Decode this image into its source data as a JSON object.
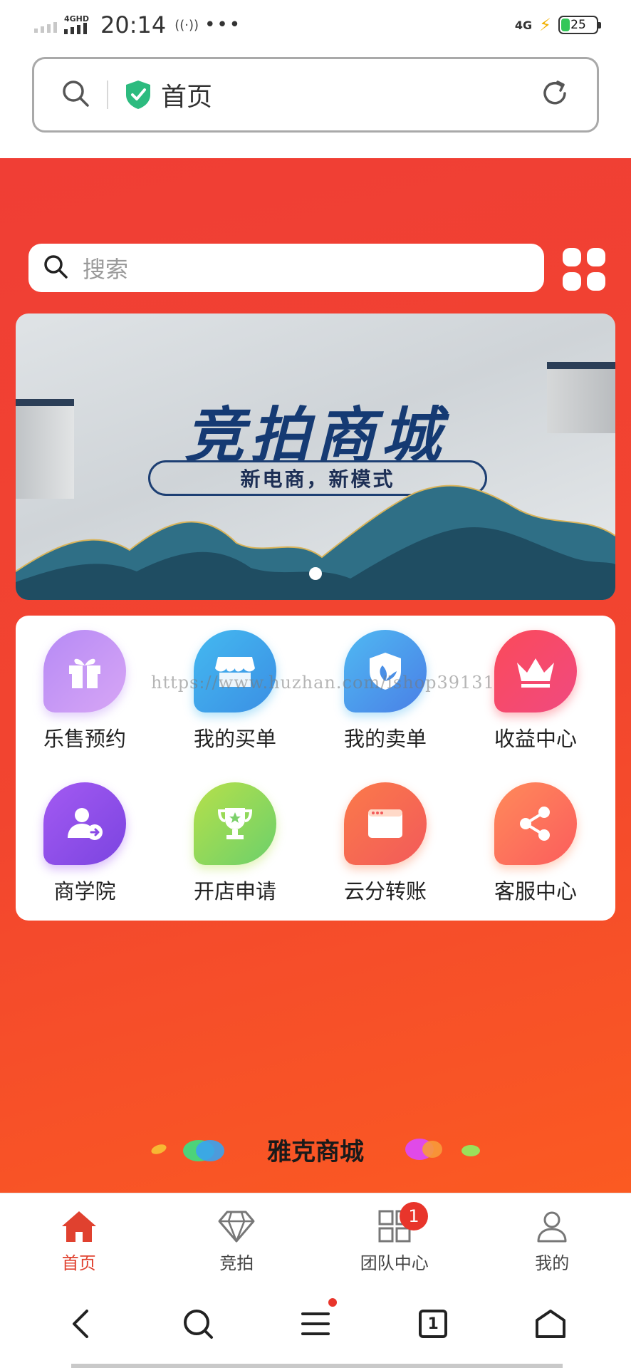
{
  "status_bar": {
    "network_left": "4GHD",
    "time": "20:14",
    "extra_icons": "((·))",
    "more": "•••",
    "network_right": "4G",
    "battery_level": "25",
    "battery_fraction": 0.25
  },
  "browser": {
    "page_title": "首页",
    "icons": [
      "search-icon",
      "shield-check-icon",
      "reload-icon"
    ]
  },
  "search": {
    "placeholder": "搜索"
  },
  "banner": {
    "title": "竞拍商城",
    "subtitle": "新电商，新模式",
    "page_index": 1,
    "page_count": 1
  },
  "watermark": "https://www.huzhan.com/ishop39131",
  "menu": {
    "items": [
      {
        "label": "乐售预约",
        "icon": "gift-icon",
        "color_a": "#b68af5",
        "color_b": "#d7a6f5"
      },
      {
        "label": "我的买单",
        "icon": "store-icon",
        "color_a": "#44b9f0",
        "color_b": "#3b8fe4"
      },
      {
        "label": "我的卖单",
        "icon": "shield-leaf-icon",
        "color_a": "#4fb9f2",
        "color_b": "#4a7fe6"
      },
      {
        "label": "收益中心",
        "icon": "crown-icon",
        "color_a": "#fb4a5a",
        "color_b": "#f04a80"
      },
      {
        "label": "商学院",
        "icon": "user-arrow-icon",
        "color_a": "#a35af2",
        "color_b": "#7b44e0"
      },
      {
        "label": "开店申请",
        "icon": "trophy-icon",
        "color_a": "#b6e04a",
        "color_b": "#6cd06b"
      },
      {
        "label": "云分转账",
        "icon": "browser-window-icon",
        "color_a": "#fb7a4a",
        "color_b": "#f25a5a"
      },
      {
        "label": "客服中心",
        "icon": "share-icon",
        "color_a": "#ff8a5a",
        "color_b": "#fb5d5d"
      }
    ]
  },
  "brand": {
    "name": "雅克商城"
  },
  "tab_bar": {
    "tabs": [
      {
        "label": "首页",
        "icon": "home-icon",
        "active": true
      },
      {
        "label": "竞拍",
        "icon": "diamond-icon",
        "active": false
      },
      {
        "label": "团队中心",
        "icon": "grid-icon",
        "active": false,
        "badge": "1"
      },
      {
        "label": "我的",
        "icon": "user-icon",
        "active": false
      }
    ]
  },
  "browser_nav": {
    "tab_count": "1",
    "icons": [
      "back-icon",
      "search-icon",
      "menu-icon",
      "tabs-icon",
      "home-icon"
    ]
  },
  "colors": {
    "accent_red": "#f03e35",
    "active_tab": "#e0412f",
    "badge_red": "#e8352b"
  }
}
